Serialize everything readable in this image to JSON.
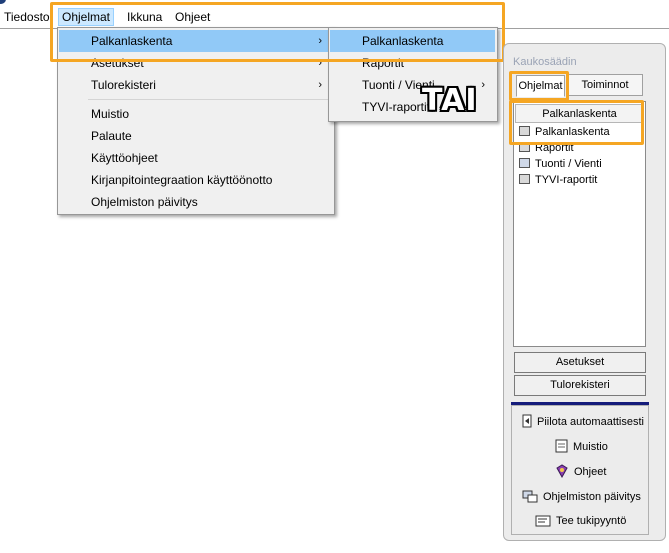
{
  "menubar": {
    "items": [
      "Tiedosto",
      "Ohjelmat",
      "Ikkuna",
      "Ohjeet"
    ]
  },
  "menu": {
    "items": [
      "Palkanlaskenta",
      "Asetukset",
      "Tulorekisteri",
      "Muistio",
      "Palaute",
      "Käyttöohjeet",
      "Kirjanpitointegraation käyttöönotto",
      "Ohjelmiston päivitys"
    ],
    "submenu_arrow": "›"
  },
  "submenu": {
    "items": [
      "Palkanlaskenta",
      "Raportit",
      "Tuonti / Vienti",
      "TYVI-raportit"
    ]
  },
  "annotation": {
    "label": "TAI",
    "color": "#f5a623"
  },
  "remote": {
    "title": "Kaukosäädin",
    "tabs": [
      "Ohjelmat",
      "Toiminnot"
    ],
    "list_header": "Palkanlaskenta",
    "list_items": [
      "Palkanlaskenta",
      "Raportit",
      "Tuonti / Vienti",
      "TYVI-raportit"
    ],
    "buttons": [
      "Asetukset",
      "Tulorekisteri"
    ],
    "actions": [
      {
        "label": "Piilota automaattisesti",
        "icon": "pin-icon"
      },
      {
        "label": "Muistio",
        "icon": "note-icon"
      },
      {
        "label": "Ohjeet",
        "icon": "help-book-icon"
      },
      {
        "label": "Ohjelmiston päivitys",
        "icon": "update-icon"
      },
      {
        "label": "Tee tukipyyntö",
        "icon": "support-request-icon"
      }
    ]
  },
  "colors": {
    "highlight": "#f5a623",
    "menu_selection": "#91c9f7",
    "accent_bar": "#141b7a"
  }
}
